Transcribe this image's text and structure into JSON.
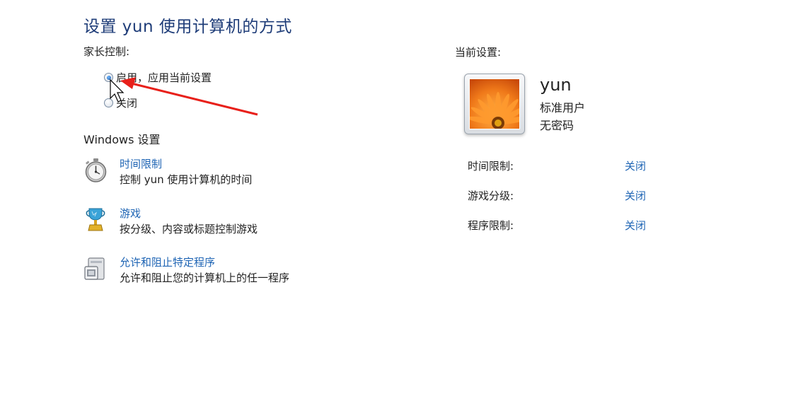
{
  "page": {
    "title": "设置 yun 使用计算机的方式"
  },
  "parental_controls": {
    "label": "家长控制:",
    "options": [
      {
        "label": "启用，应用当前设置",
        "checked": true
      },
      {
        "label": "关闭",
        "checked": false
      }
    ]
  },
  "windows_settings": {
    "label": "Windows 设置",
    "items": [
      {
        "title": "时间限制",
        "description": "控制 yun 使用计算机的时间",
        "icon": "stopwatch-icon"
      },
      {
        "title": "游戏",
        "description": "按分级、内容或标题控制游戏",
        "icon": "trophy-icon"
      },
      {
        "title": "允许和阻止特定程序",
        "description": "允许和阻止您的计算机上的任一程序",
        "icon": "program-window-icon"
      }
    ]
  },
  "current_settings": {
    "label": "当前设置:",
    "user": {
      "name": "yun",
      "account_type": "标准用户",
      "password_status": "无密码"
    },
    "rows": [
      {
        "label": "时间限制:",
        "value": "关闭"
      },
      {
        "label": "游戏分级:",
        "value": "关闭"
      },
      {
        "label": "程序限制:",
        "value": "关闭"
      }
    ]
  },
  "colors": {
    "title": "#1e3c78",
    "link": "#1e64b4",
    "annotation_arrow": "#e8201a"
  }
}
